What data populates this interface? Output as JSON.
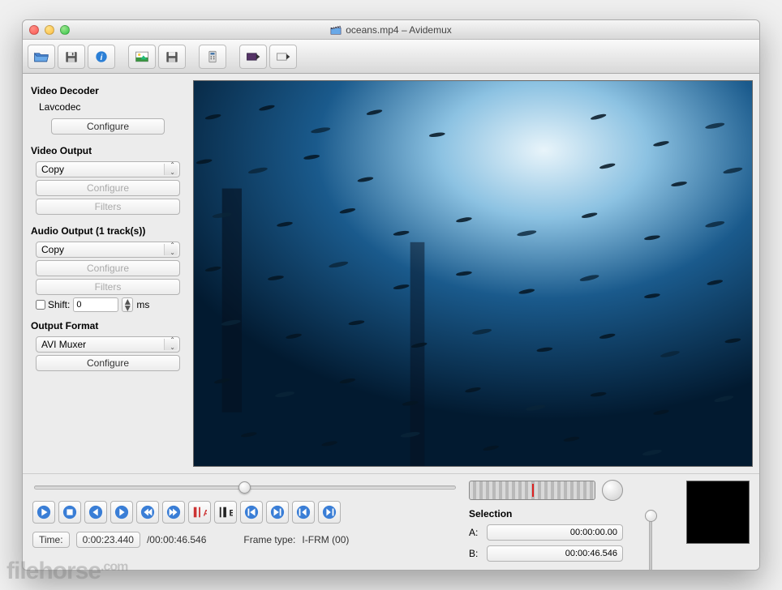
{
  "window": {
    "title": "oceans.mp4 – Avidemux"
  },
  "sidebar": {
    "video_decoder": {
      "title": "Video Decoder",
      "codec": "Lavcodec",
      "configure": "Configure"
    },
    "video_output": {
      "title": "Video Output",
      "select": "Copy",
      "configure": "Configure",
      "filters": "Filters"
    },
    "audio_output": {
      "title": "Audio Output (1 track(s))",
      "select": "Copy",
      "configure": "Configure",
      "filters": "Filters",
      "shift_label": "Shift:",
      "shift_value": "0",
      "shift_unit": "ms"
    },
    "output_format": {
      "title": "Output Format",
      "select": "AVI Muxer",
      "configure": "Configure"
    }
  },
  "timeline": {
    "position_pct": 50,
    "time_label": "Time:",
    "current": "0:00:23.440",
    "duration": "/00:00:46.546",
    "frame_type_label": "Frame type:",
    "frame_type": "I-FRM (00)"
  },
  "selection": {
    "title": "Selection",
    "a_label": "A:",
    "a_value": "00:00:00.00",
    "b_label": "B:",
    "b_value": "00:00:46.546"
  },
  "watermark": "filehorse",
  "watermark_suffix": ".com"
}
